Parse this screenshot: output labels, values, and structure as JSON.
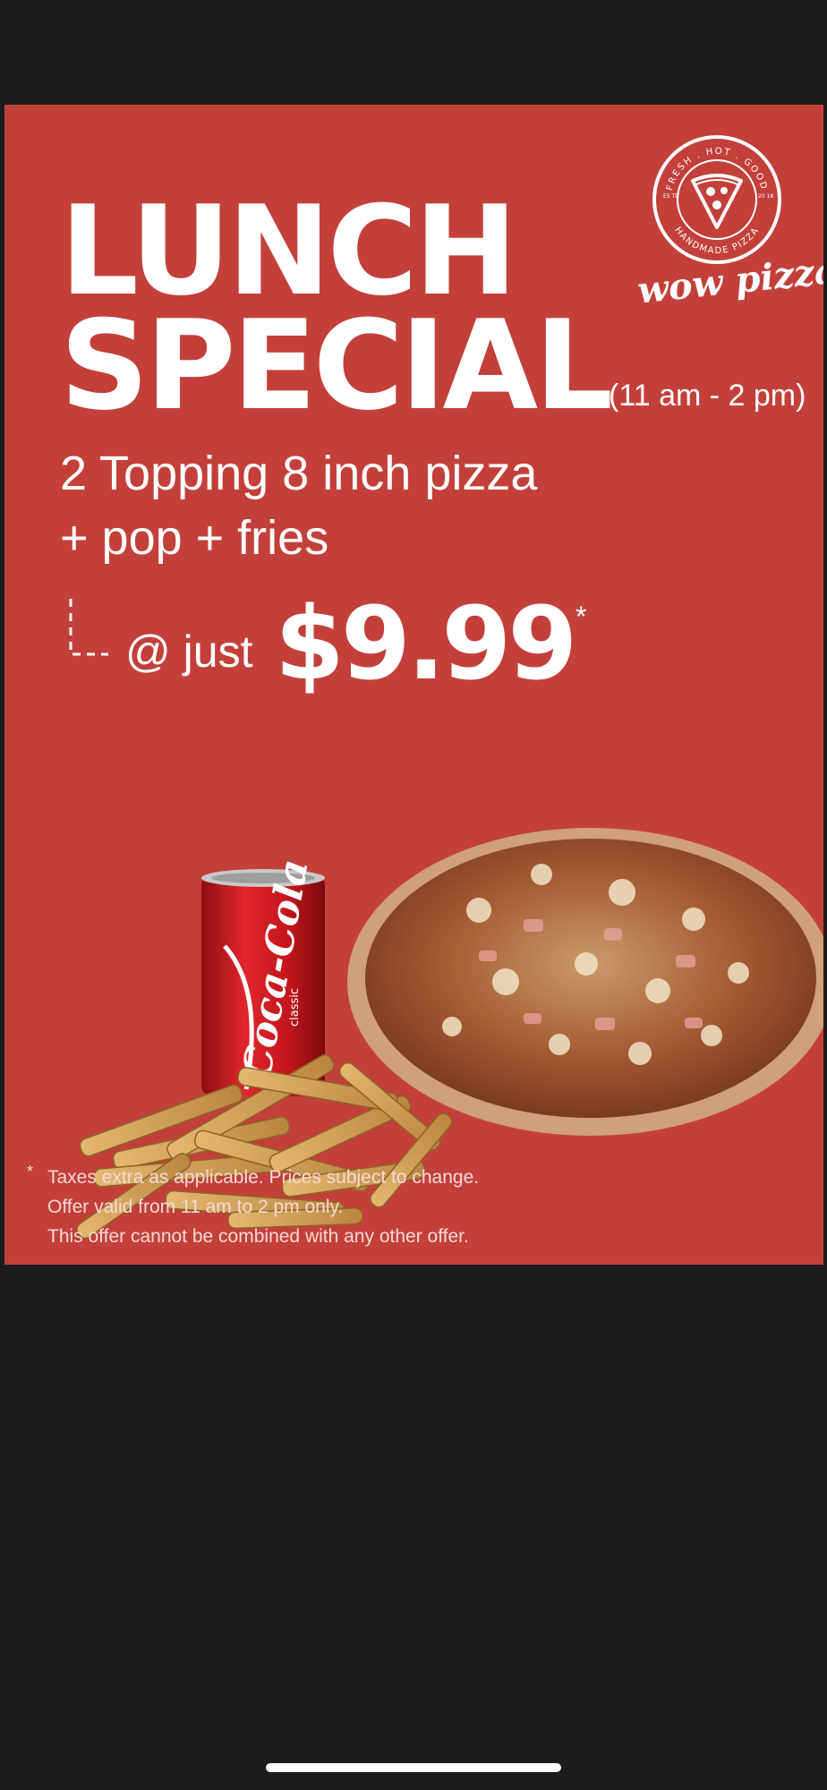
{
  "poster": {
    "title_line1": "LUNCH",
    "title_line2": "SPECIAL",
    "hours": "(11 am - 2 pm)",
    "offer_line1": "2 Topping 8 inch pizza",
    "offer_line2": "+ pop + fries",
    "price_prefix": "@ just",
    "price": "$9.99",
    "asterisk": "*",
    "logo": {
      "badge_top_text": "FRESH . HOT . GOOD",
      "badge_bottom_text": "HANDMADE PIZZA",
      "est_left": "ES TD",
      "est_right": "20 18",
      "brand_name": "wow pizza"
    },
    "can_brand": "Coca-Cola",
    "can_variant": "classic",
    "disclaimer_star": "*",
    "disclaimer_lines": [
      "Taxes extra as applicable. Prices subject to change.",
      "Offer valid from 11 am to 2 pm only.",
      "This offer cannot be combined with any other offer."
    ]
  },
  "colors": {
    "background": "#1c1c1e",
    "poster_red": "#c3403a",
    "text": "#ffffff"
  },
  "icons": {
    "logo": "pizza-slice-badge-icon",
    "connector": "dashed-arrow-icon",
    "home_indicator": "home-indicator-bar"
  }
}
